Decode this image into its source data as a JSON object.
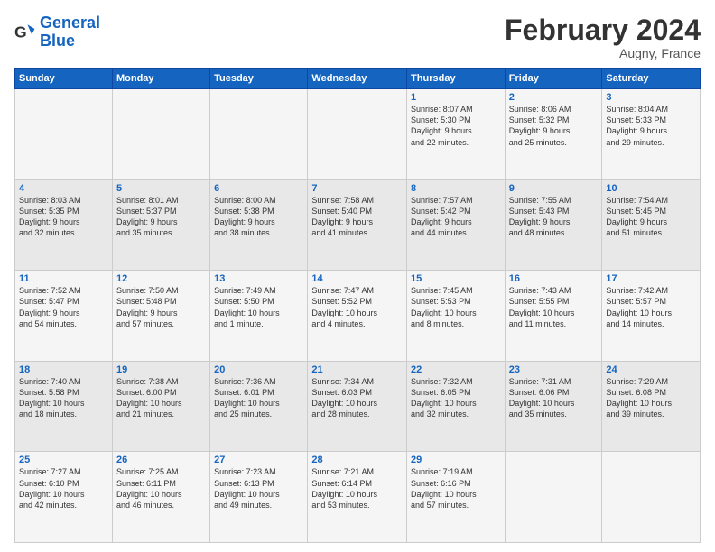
{
  "logo": {
    "text_general": "General",
    "text_blue": "Blue"
  },
  "header": {
    "month": "February 2024",
    "location": "Augny, France"
  },
  "weekdays": [
    "Sunday",
    "Monday",
    "Tuesday",
    "Wednesday",
    "Thursday",
    "Friday",
    "Saturday"
  ],
  "weeks": [
    [
      {
        "day": "",
        "content": ""
      },
      {
        "day": "",
        "content": ""
      },
      {
        "day": "",
        "content": ""
      },
      {
        "day": "",
        "content": ""
      },
      {
        "day": "1",
        "content": "Sunrise: 8:07 AM\nSunset: 5:30 PM\nDaylight: 9 hours\nand 22 minutes."
      },
      {
        "day": "2",
        "content": "Sunrise: 8:06 AM\nSunset: 5:32 PM\nDaylight: 9 hours\nand 25 minutes."
      },
      {
        "day": "3",
        "content": "Sunrise: 8:04 AM\nSunset: 5:33 PM\nDaylight: 9 hours\nand 29 minutes."
      }
    ],
    [
      {
        "day": "4",
        "content": "Sunrise: 8:03 AM\nSunset: 5:35 PM\nDaylight: 9 hours\nand 32 minutes."
      },
      {
        "day": "5",
        "content": "Sunrise: 8:01 AM\nSunset: 5:37 PM\nDaylight: 9 hours\nand 35 minutes."
      },
      {
        "day": "6",
        "content": "Sunrise: 8:00 AM\nSunset: 5:38 PM\nDaylight: 9 hours\nand 38 minutes."
      },
      {
        "day": "7",
        "content": "Sunrise: 7:58 AM\nSunset: 5:40 PM\nDaylight: 9 hours\nand 41 minutes."
      },
      {
        "day": "8",
        "content": "Sunrise: 7:57 AM\nSunset: 5:42 PM\nDaylight: 9 hours\nand 44 minutes."
      },
      {
        "day": "9",
        "content": "Sunrise: 7:55 AM\nSunset: 5:43 PM\nDaylight: 9 hours\nand 48 minutes."
      },
      {
        "day": "10",
        "content": "Sunrise: 7:54 AM\nSunset: 5:45 PM\nDaylight: 9 hours\nand 51 minutes."
      }
    ],
    [
      {
        "day": "11",
        "content": "Sunrise: 7:52 AM\nSunset: 5:47 PM\nDaylight: 9 hours\nand 54 minutes."
      },
      {
        "day": "12",
        "content": "Sunrise: 7:50 AM\nSunset: 5:48 PM\nDaylight: 9 hours\nand 57 minutes."
      },
      {
        "day": "13",
        "content": "Sunrise: 7:49 AM\nSunset: 5:50 PM\nDaylight: 10 hours\nand 1 minute."
      },
      {
        "day": "14",
        "content": "Sunrise: 7:47 AM\nSunset: 5:52 PM\nDaylight: 10 hours\nand 4 minutes."
      },
      {
        "day": "15",
        "content": "Sunrise: 7:45 AM\nSunset: 5:53 PM\nDaylight: 10 hours\nand 8 minutes."
      },
      {
        "day": "16",
        "content": "Sunrise: 7:43 AM\nSunset: 5:55 PM\nDaylight: 10 hours\nand 11 minutes."
      },
      {
        "day": "17",
        "content": "Sunrise: 7:42 AM\nSunset: 5:57 PM\nDaylight: 10 hours\nand 14 minutes."
      }
    ],
    [
      {
        "day": "18",
        "content": "Sunrise: 7:40 AM\nSunset: 5:58 PM\nDaylight: 10 hours\nand 18 minutes."
      },
      {
        "day": "19",
        "content": "Sunrise: 7:38 AM\nSunset: 6:00 PM\nDaylight: 10 hours\nand 21 minutes."
      },
      {
        "day": "20",
        "content": "Sunrise: 7:36 AM\nSunset: 6:01 PM\nDaylight: 10 hours\nand 25 minutes."
      },
      {
        "day": "21",
        "content": "Sunrise: 7:34 AM\nSunset: 6:03 PM\nDaylight: 10 hours\nand 28 minutes."
      },
      {
        "day": "22",
        "content": "Sunrise: 7:32 AM\nSunset: 6:05 PM\nDaylight: 10 hours\nand 32 minutes."
      },
      {
        "day": "23",
        "content": "Sunrise: 7:31 AM\nSunset: 6:06 PM\nDaylight: 10 hours\nand 35 minutes."
      },
      {
        "day": "24",
        "content": "Sunrise: 7:29 AM\nSunset: 6:08 PM\nDaylight: 10 hours\nand 39 minutes."
      }
    ],
    [
      {
        "day": "25",
        "content": "Sunrise: 7:27 AM\nSunset: 6:10 PM\nDaylight: 10 hours\nand 42 minutes."
      },
      {
        "day": "26",
        "content": "Sunrise: 7:25 AM\nSunset: 6:11 PM\nDaylight: 10 hours\nand 46 minutes."
      },
      {
        "day": "27",
        "content": "Sunrise: 7:23 AM\nSunset: 6:13 PM\nDaylight: 10 hours\nand 49 minutes."
      },
      {
        "day": "28",
        "content": "Sunrise: 7:21 AM\nSunset: 6:14 PM\nDaylight: 10 hours\nand 53 minutes."
      },
      {
        "day": "29",
        "content": "Sunrise: 7:19 AM\nSunset: 6:16 PM\nDaylight: 10 hours\nand 57 minutes."
      },
      {
        "day": "",
        "content": ""
      },
      {
        "day": "",
        "content": ""
      }
    ]
  ]
}
